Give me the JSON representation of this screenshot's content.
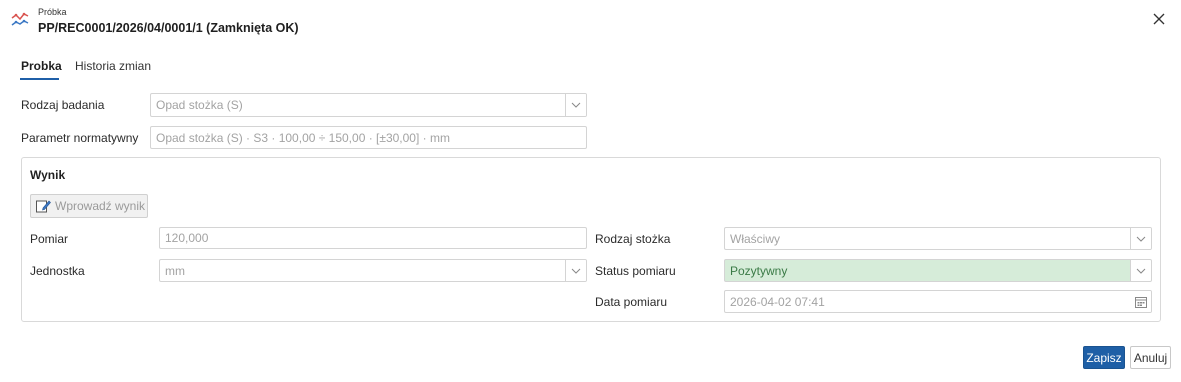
{
  "header": {
    "subtitle": "Próbka",
    "title": "PP/REC0001/2026/04/0001/1 (Zamknięta OK)",
    "icon": "chart-line-icon"
  },
  "tabs": [
    {
      "label": "Probka",
      "active": true
    },
    {
      "label": "Historia zmian",
      "active": false
    }
  ],
  "form": {
    "test_type_label": "Rodzaj badania",
    "test_type_value": "Opad stożka (S)",
    "norm_param_label": "Parametr normatywny",
    "norm_param_value": "Opad stożka (S) · S3 · 100,00 ÷ 150,00 · [±30,00] · mm"
  },
  "result": {
    "group_title": "Wynik",
    "enter_button_label": "Wprowadź wynik",
    "measurement_label": "Pomiar",
    "measurement_value": "120,000",
    "unit_label": "Jednostka",
    "unit_value": "mm",
    "cone_type_label": "Rodzaj stożka",
    "cone_type_value": "Właściwy",
    "status_label": "Status pomiaru",
    "status_value": "Pozytywny",
    "date_label": "Data pomiaru",
    "date_value": "2026-04-02 07:41"
  },
  "footer": {
    "save_label": "Zapisz",
    "cancel_label": "Anuluj"
  },
  "colors": {
    "accent": "#1e5fa6",
    "status_positive_bg": "#d6ecd9",
    "status_positive_text": "#3a7a46"
  }
}
